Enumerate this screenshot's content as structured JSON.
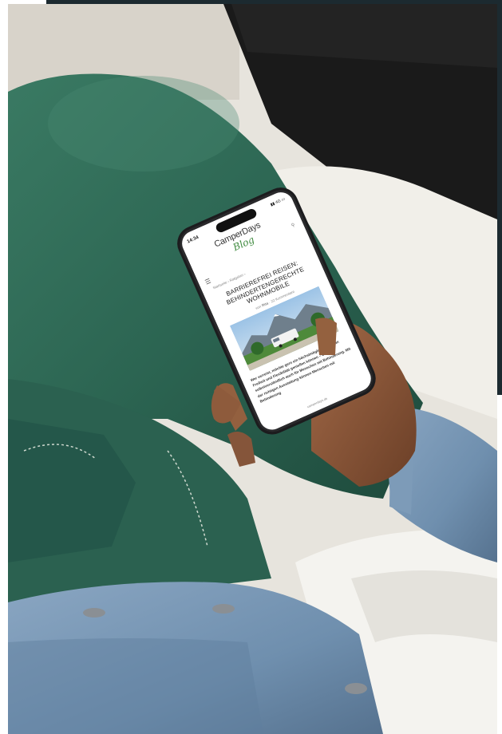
{
  "phone": {
    "status_time": "14:34",
    "status_icons": "▮▮ 4G ▭",
    "logo_main": "CamperDays",
    "logo_script": "Blog",
    "menu_icon": "hamburger-menu-icon",
    "search_icon": "search-icon",
    "breadcrumb": "Startseite  ›  Ratgeber  ›",
    "article_title": "BARRIEREFREI REISEN: BEHINDERTENGERECHTE WOHNMOBILE",
    "byline_prefix": "von",
    "byline_author": "Rita",
    "byline_comments": "22 Kommentare",
    "article_body": "Wer verreist, möchte gern ein höchstmögliches Maß an Freiheit und Flexibilität genießen können – das gilt selbstverständlich auch für Menschen mit Behinderung. Mit der richtigen Ausstattung können Menschen mit Behinderung",
    "url": "camperdays.de"
  },
  "colors": {
    "frame_accent": "#1c2a30",
    "brand_green": "#3e8a3e",
    "trousers_green": "#2f6a55",
    "denim_blue": "#6f8fae"
  }
}
